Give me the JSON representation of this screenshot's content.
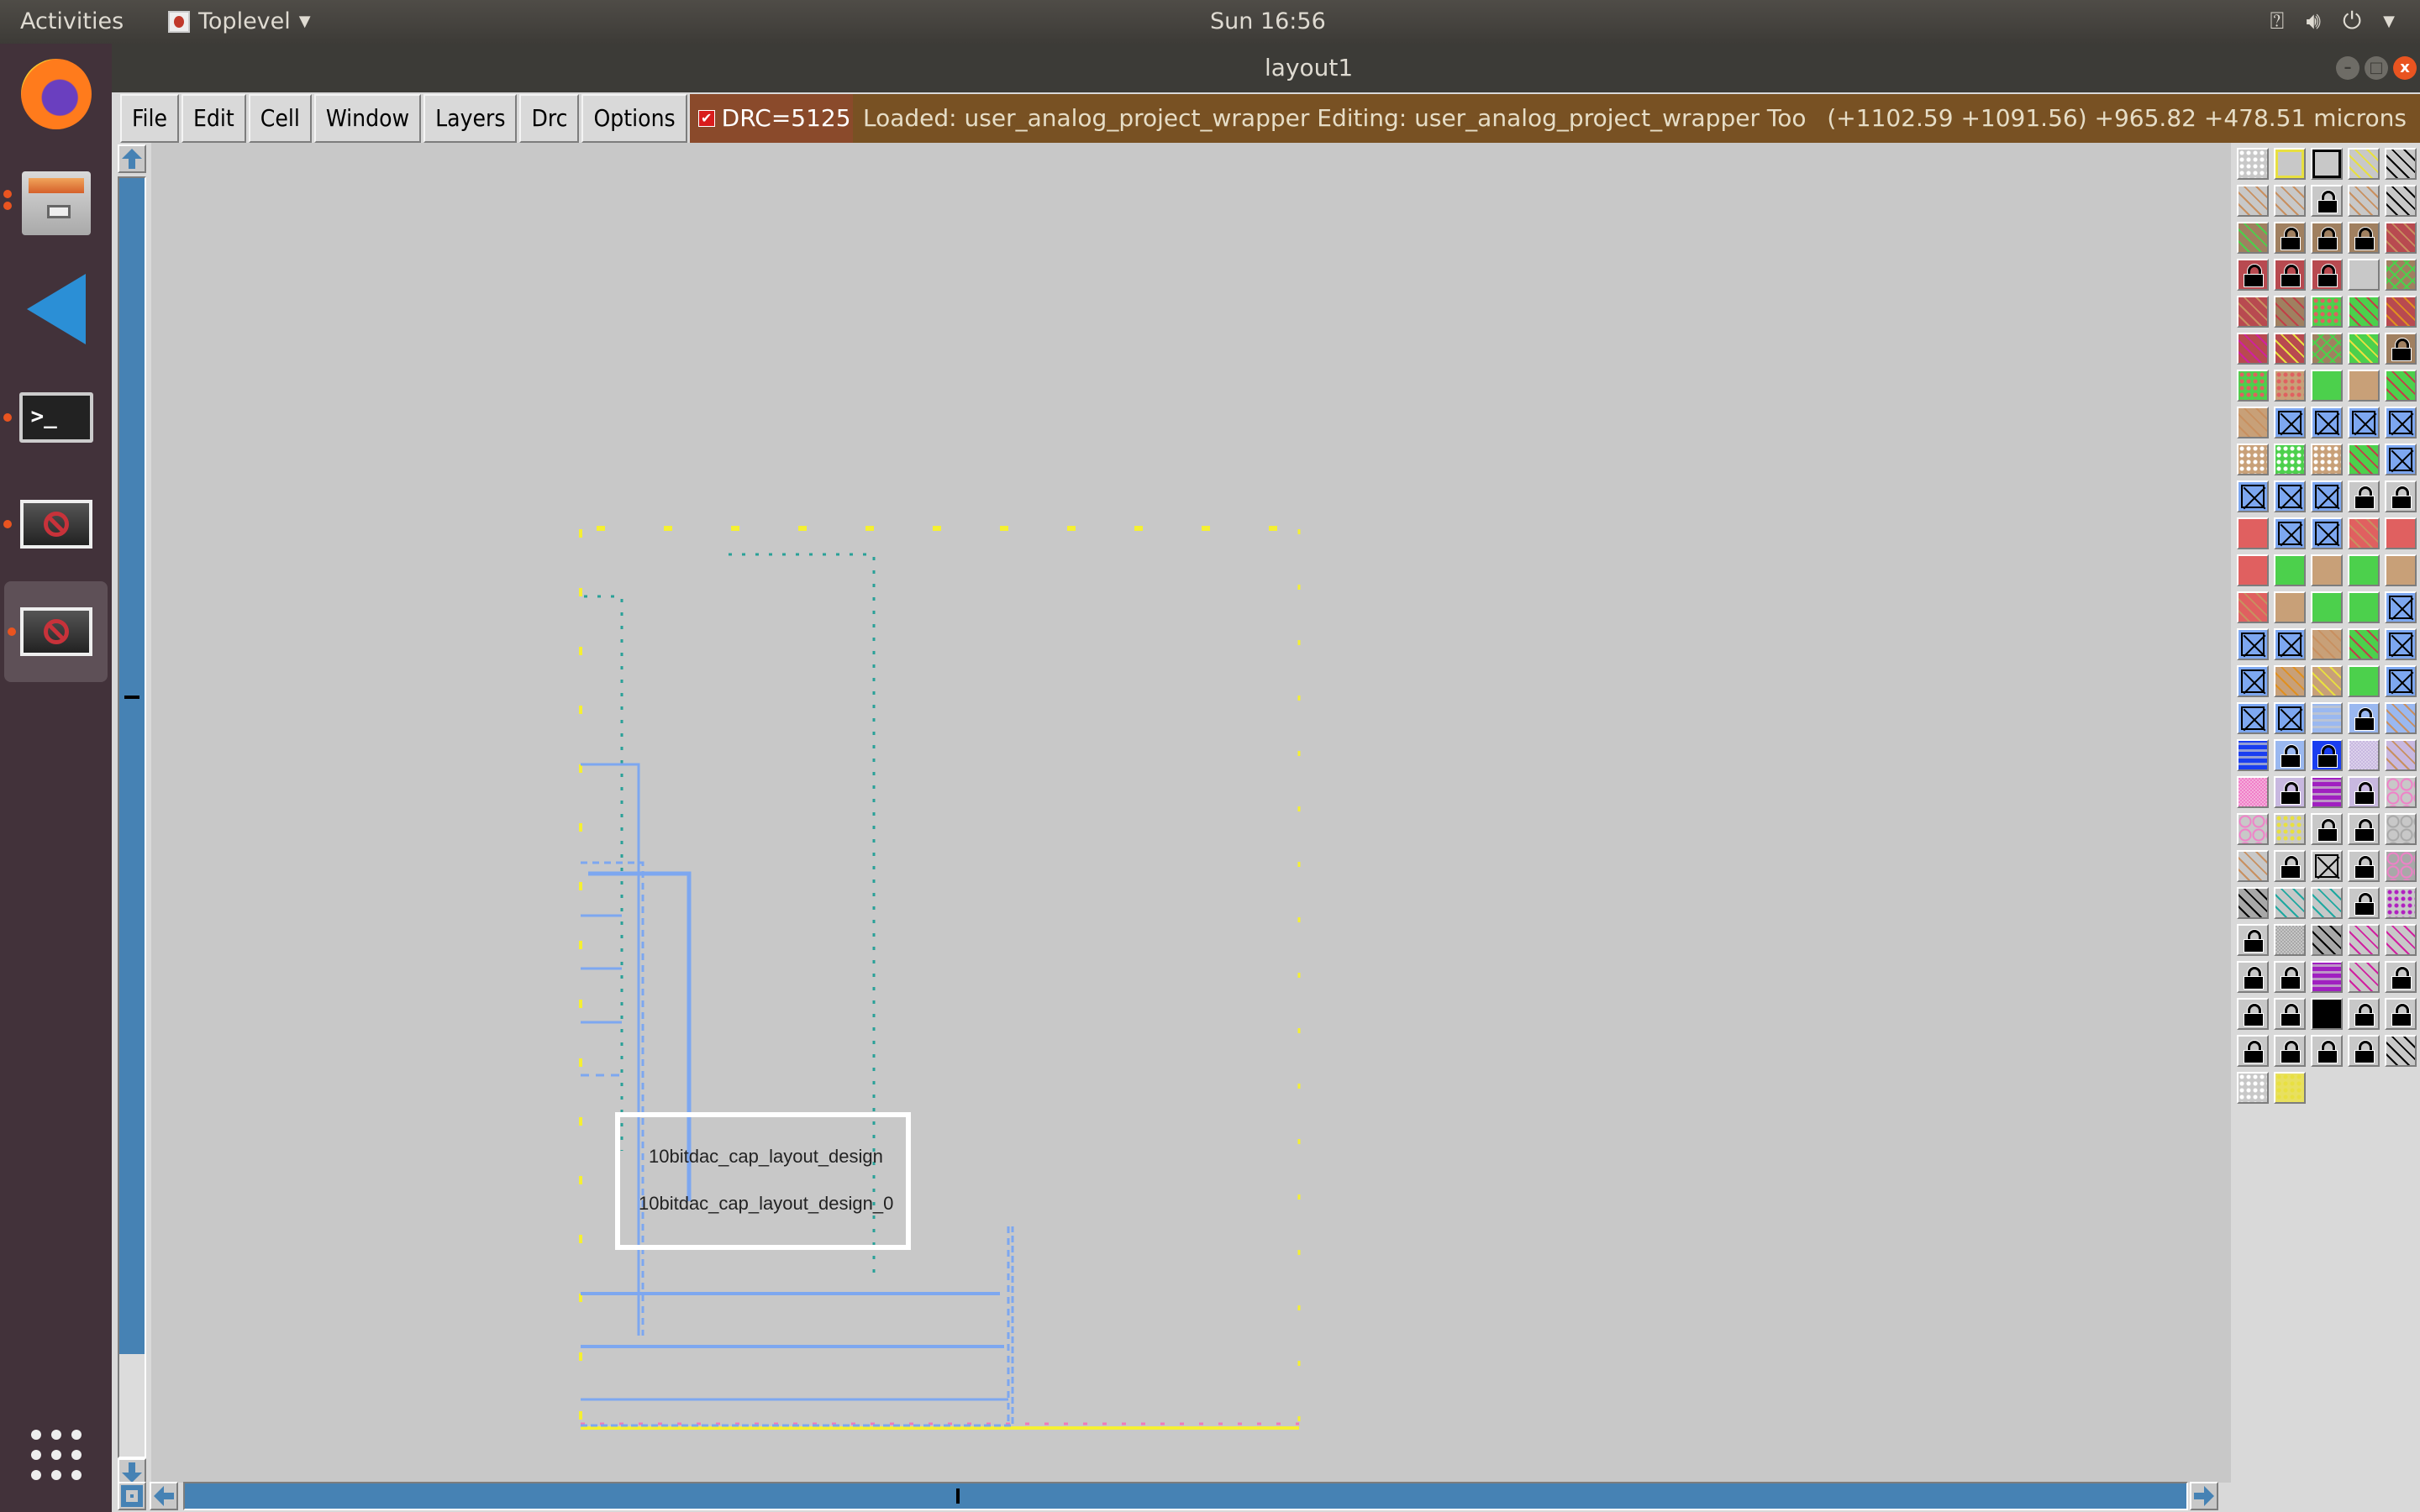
{
  "topbar": {
    "activities": "Activities",
    "app_name": "Toplevel",
    "clock": "Sun 16:56",
    "tray_icons": [
      "network-icon",
      "volume-icon",
      "power-icon"
    ]
  },
  "dock": {
    "items": [
      {
        "name": "firefox",
        "running": false
      },
      {
        "name": "files",
        "running": true
      },
      {
        "name": "vscode",
        "running": false
      },
      {
        "name": "terminal",
        "running": true
      },
      {
        "name": "magic-window-1",
        "running": true
      },
      {
        "name": "magic-window-2",
        "running": true,
        "active": true
      }
    ],
    "apps_grid": "show-applications-icon"
  },
  "window": {
    "title": "layout1",
    "controls": {
      "minimize": "–",
      "maximize": "□",
      "close": "x"
    }
  },
  "menu": {
    "items": [
      "File",
      "Edit",
      "Cell",
      "Window",
      "Layers",
      "Drc",
      "Options"
    ],
    "drc_label": "DRC=5125",
    "drc_checked": true
  },
  "status": {
    "message": "Loaded: user_analog_project_wrapper Editing: user_analog_project_wrapper Tool: box  Te",
    "coords": "(+1102.59 +1091.56) +965.82 +478.51 microns"
  },
  "scroll": {
    "vertical_thumb_fraction": 0.92,
    "horizontal_thumb_fraction": 1.0
  },
  "canvas": {
    "cell_instance": {
      "name": "10bitdac_cap_layout_design",
      "instance": "10bitdac_cap_layout_design_0"
    },
    "colors": {
      "background": "#c8c8c8",
      "boundary": "#f5f032",
      "metal": "#7da7f0",
      "via": "#2aa198",
      "pin": "#f27ab8"
    }
  },
  "palette": {
    "cells": [
      {
        "bg": "#c8c8c8",
        "pattern": "dots-white"
      },
      {
        "bg": "#c8c8c8",
        "pattern": "outline-yellow"
      },
      {
        "bg": "#c8c8c8",
        "pattern": "outline-black"
      },
      {
        "bg": "#c8c8c8",
        "pattern": "diag-yellow"
      },
      {
        "bg": "#c8c8c8",
        "pattern": "diag-black"
      },
      {
        "bg": "#c8c8c8",
        "pattern": "diag-tan"
      },
      {
        "bg": "#c8c8c8",
        "pattern": "diag-tan"
      },
      {
        "bg": "#c8c8c8",
        "pattern": "lock"
      },
      {
        "bg": "#c8c8c8",
        "pattern": "diag-tan"
      },
      {
        "bg": "#c8c8c8",
        "pattern": "diag-black"
      },
      {
        "bg": "#a08060",
        "pattern": "diag-green"
      },
      {
        "bg": "#a08060",
        "pattern": "lock"
      },
      {
        "bg": "#a08060",
        "pattern": "lock"
      },
      {
        "bg": "#a08060",
        "pattern": "lock"
      },
      {
        "bg": "#b84a50",
        "pattern": "diag-tan"
      },
      {
        "bg": "#b84a50",
        "pattern": "lock"
      },
      {
        "bg": "#b84a50",
        "pattern": "lock"
      },
      {
        "bg": "#b84a50",
        "pattern": "lock"
      },
      {
        "bg": "#c8c8c8",
        "pattern": "none"
      },
      {
        "bg": "#a08060",
        "pattern": "cross-green"
      },
      {
        "bg": "#b84a50",
        "pattern": "diag-tan"
      },
      {
        "bg": "#a08060",
        "pattern": "diag-red"
      },
      {
        "bg": "#4cd04c",
        "pattern": "dots-red"
      },
      {
        "bg": "#4cd04c",
        "pattern": "diag-red"
      },
      {
        "bg": "#b84a50",
        "pattern": "diag-orange"
      },
      {
        "bg": "#b84a50",
        "pattern": "diag-magenta"
      },
      {
        "bg": "#b84a50",
        "pattern": "diag-yellow"
      },
      {
        "bg": "#a08060",
        "pattern": "cross-green"
      },
      {
        "bg": "#4cd04c",
        "pattern": "diag-yellow"
      },
      {
        "bg": "#a08060",
        "pattern": "lock"
      },
      {
        "bg": "#4cd04c",
        "pattern": "dots-red"
      },
      {
        "bg": "#c8a078",
        "pattern": "dots-red"
      },
      {
        "bg": "#4cd04c",
        "pattern": "none"
      },
      {
        "bg": "#c8a078",
        "pattern": "none"
      },
      {
        "bg": "#4cd04c",
        "pattern": "diag-red"
      },
      {
        "bg": "#c8a078",
        "pattern": "diag-tan"
      },
      {
        "bg": "#7da7f0",
        "pattern": "x"
      },
      {
        "bg": "#7da7f0",
        "pattern": "x"
      },
      {
        "bg": "#7da7f0",
        "pattern": "x"
      },
      {
        "bg": "#7da7f0",
        "pattern": "x"
      },
      {
        "bg": "#c8a078",
        "pattern": "dots-white"
      },
      {
        "bg": "#4cd04c",
        "pattern": "dots-white"
      },
      {
        "bg": "#c8a078",
        "pattern": "dots-white"
      },
      {
        "bg": "#4cd04c",
        "pattern": "diag-red"
      },
      {
        "bg": "#7da7f0",
        "pattern": "x"
      },
      {
        "bg": "#7da7f0",
        "pattern": "x"
      },
      {
        "bg": "#7da7f0",
        "pattern": "x"
      },
      {
        "bg": "#7da7f0",
        "pattern": "x"
      },
      {
        "bg": "#c8c8c8",
        "pattern": "lock"
      },
      {
        "bg": "#c8c8c8",
        "pattern": "lock"
      },
      {
        "bg": "#e06060",
        "pattern": "none"
      },
      {
        "bg": "#7da7f0",
        "pattern": "x"
      },
      {
        "bg": "#7da7f0",
        "pattern": "x"
      },
      {
        "bg": "#e06060",
        "pattern": "diag-tan"
      },
      {
        "bg": "#e06060",
        "pattern": "none"
      },
      {
        "bg": "#e06060",
        "pattern": "none"
      },
      {
        "bg": "#4cd04c",
        "pattern": "none"
      },
      {
        "bg": "#c8a078",
        "pattern": "none"
      },
      {
        "bg": "#4cd04c",
        "pattern": "none"
      },
      {
        "bg": "#c8a078",
        "pattern": "none"
      },
      {
        "bg": "#e06060",
        "pattern": "diag-tan"
      },
      {
        "bg": "#c8a078",
        "pattern": "none"
      },
      {
        "bg": "#4cd04c",
        "pattern": "none"
      },
      {
        "bg": "#4cd04c",
        "pattern": "none"
      },
      {
        "bg": "#7da7f0",
        "pattern": "x"
      },
      {
        "bg": "#7da7f0",
        "pattern": "x"
      },
      {
        "bg": "#7da7f0",
        "pattern": "x"
      },
      {
        "bg": "#c8a078",
        "pattern": "diag-tan"
      },
      {
        "bg": "#4cd04c",
        "pattern": "diag-red"
      },
      {
        "bg": "#7da7f0",
        "pattern": "x"
      },
      {
        "bg": "#7da7f0",
        "pattern": "x"
      },
      {
        "bg": "#c8a078",
        "pattern": "diag-orange"
      },
      {
        "bg": "#c8a078",
        "pattern": "diag-yellow"
      },
      {
        "bg": "#4cd04c",
        "pattern": "none"
      },
      {
        "bg": "#7da7f0",
        "pattern": "x"
      },
      {
        "bg": "#7da7f0",
        "pattern": "x"
      },
      {
        "bg": "#7da7f0",
        "pattern": "x"
      },
      {
        "bg": "#9ab8f0",
        "pattern": "waves"
      },
      {
        "bg": "#9ab8f0",
        "pattern": "lock"
      },
      {
        "bg": "#9ab8f0",
        "pattern": "diag-tan"
      },
      {
        "bg": "#1a3ef0",
        "pattern": "waves"
      },
      {
        "bg": "#9ab8f0",
        "pattern": "lock"
      },
      {
        "bg": "#1a3ef0",
        "pattern": "lock"
      },
      {
        "bg": "#c8b8e0",
        "pattern": "check"
      },
      {
        "bg": "#c8b8e0",
        "pattern": "diag-tan"
      },
      {
        "bg": "#f080c8",
        "pattern": "check"
      },
      {
        "bg": "#c8b8e0",
        "pattern": "lock"
      },
      {
        "bg": "#a020c0",
        "pattern": "waves"
      },
      {
        "bg": "#c8b8e0",
        "pattern": "lock"
      },
      {
        "bg": "#c8c8c8",
        "pattern": "rings-pink"
      },
      {
        "bg": "#c8c8c8",
        "pattern": "rings-pink"
      },
      {
        "bg": "#c8c8c8",
        "pattern": "dots-yellow"
      },
      {
        "bg": "#c8c8c8",
        "pattern": "lock"
      },
      {
        "bg": "#c8c8c8",
        "pattern": "lock"
      },
      {
        "bg": "#c8c8c8",
        "pattern": "rings-grey"
      },
      {
        "bg": "#c8c8c8",
        "pattern": "diag-tan"
      },
      {
        "bg": "#c8c8c8",
        "pattern": "lock"
      },
      {
        "bg": "#c8c8c8",
        "pattern": "x"
      },
      {
        "bg": "#c8c8c8",
        "pattern": "lock"
      },
      {
        "bg": "#a8a8a8",
        "pattern": "rings-pink"
      },
      {
        "bg": "#a8a8a8",
        "pattern": "diag-black"
      },
      {
        "bg": "#c8c8c8",
        "pattern": "diag-teal"
      },
      {
        "bg": "#c8c8c8",
        "pattern": "diag-teal"
      },
      {
        "bg": "#c8c8c8",
        "pattern": "lock"
      },
      {
        "bg": "#c8c8c8",
        "pattern": "dots-magenta"
      },
      {
        "bg": "#c8c8c8",
        "pattern": "lock"
      },
      {
        "bg": "#a8a8a8",
        "pattern": "check"
      },
      {
        "bg": "#a8a8a8",
        "pattern": "diag-black"
      },
      {
        "bg": "#c8c8c8",
        "pattern": "diag-magenta"
      },
      {
        "bg": "#c8c8c8",
        "pattern": "diag-magenta"
      },
      {
        "bg": "#c8c8c8",
        "pattern": "lock"
      },
      {
        "bg": "#c8c8c8",
        "pattern": "lock"
      },
      {
        "bg": "#a020c0",
        "pattern": "waves"
      },
      {
        "bg": "#c8c8c8",
        "pattern": "diag-magenta"
      },
      {
        "bg": "#c8c8c8",
        "pattern": "lock"
      },
      {
        "bg": "#c8c8c8",
        "pattern": "lock"
      },
      {
        "bg": "#c8c8c8",
        "pattern": "lock"
      },
      {
        "bg": "#000000",
        "pattern": "none"
      },
      {
        "bg": "#c8c8c8",
        "pattern": "lock"
      },
      {
        "bg": "#c8c8c8",
        "pattern": "lock"
      },
      {
        "bg": "#c8c8c8",
        "pattern": "lock"
      },
      {
        "bg": "#c8c8c8",
        "pattern": "lock"
      },
      {
        "bg": "#c8c8c8",
        "pattern": "lock"
      },
      {
        "bg": "#c8c8c8",
        "pattern": "lock"
      },
      {
        "bg": "#c8c8c8",
        "pattern": "diag-black"
      },
      {
        "bg": "#c8c8c8",
        "pattern": "dots-white"
      },
      {
        "bg": "#e8e060",
        "pattern": "dots-yellow"
      }
    ]
  }
}
